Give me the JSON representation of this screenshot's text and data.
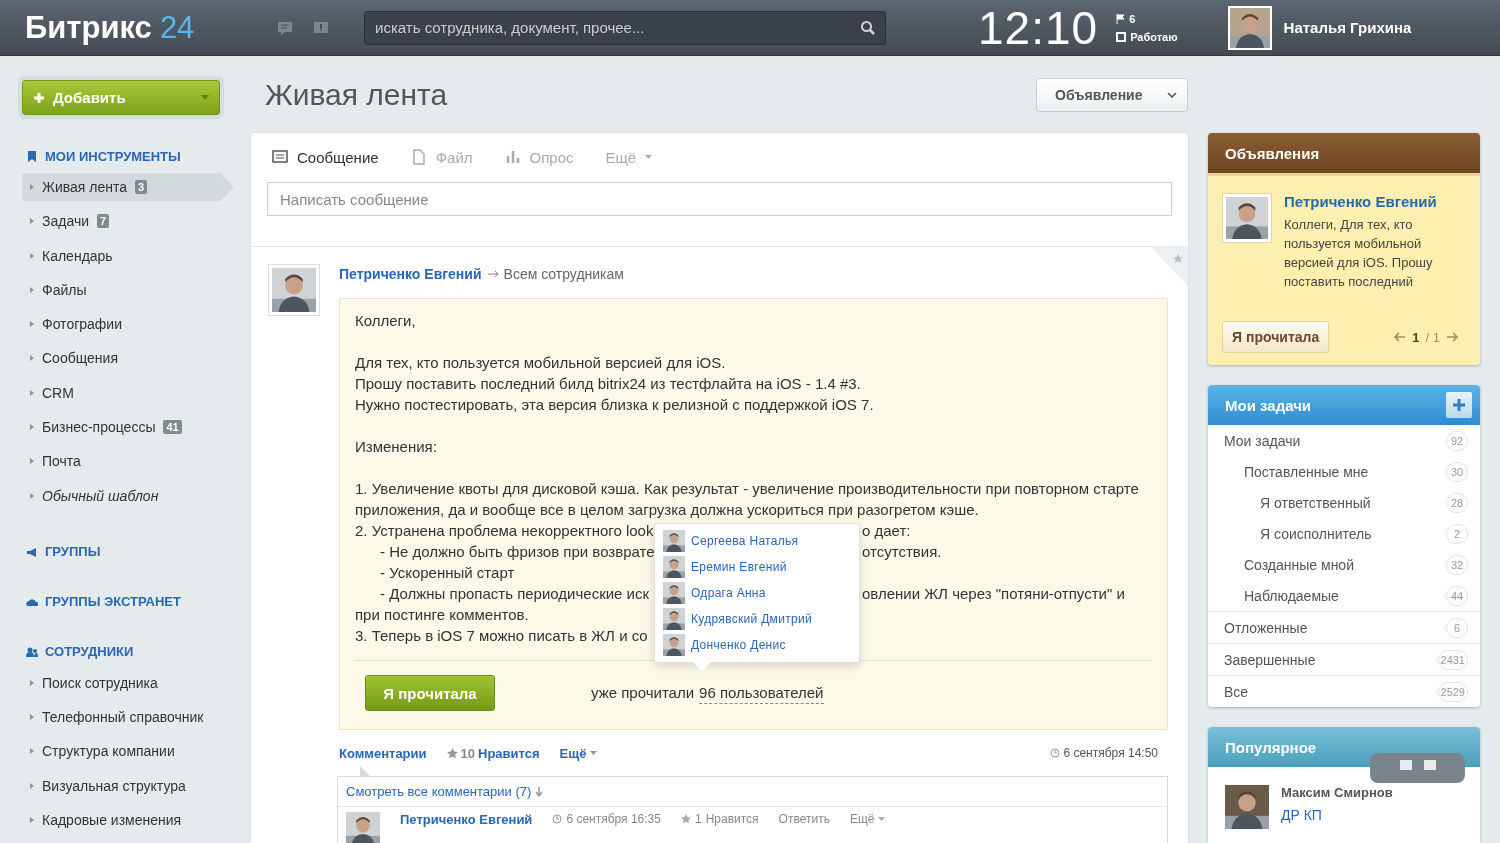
{
  "header": {
    "logo": {
      "name": "Битрикс",
      "number": "24"
    },
    "search": {
      "placeholder": "искать сотрудника, документ, прочее..."
    },
    "time": "12:10",
    "flags": "6",
    "status": "Работаю",
    "user": "Наталья Грихина"
  },
  "add_button": {
    "label": "Добавить"
  },
  "sidebar": [
    {
      "title": "МОИ ИНСТРУМЕНТЫ",
      "items": [
        {
          "label": "Живая лента",
          "badge": "3",
          "selected": true,
          "kind": "link"
        },
        {
          "label": "Задачи",
          "badge": "7",
          "selected": false,
          "kind": "link"
        },
        {
          "label": "Календарь",
          "selected": false,
          "kind": "link"
        },
        {
          "label": "Файлы",
          "selected": false,
          "kind": "link"
        },
        {
          "label": "Фотографии",
          "selected": false,
          "kind": "link"
        },
        {
          "label": "Сообщения",
          "selected": false,
          "kind": "link"
        },
        {
          "label": "CRM",
          "selected": false,
          "kind": "link"
        },
        {
          "label": "Бизнес-процессы",
          "badge": "41",
          "selected": false,
          "kind": "link"
        },
        {
          "label": "Почта",
          "selected": false,
          "kind": "link"
        },
        {
          "label": "Обычный шаблон",
          "selected": false,
          "kind": "template"
        }
      ]
    },
    {
      "title": "ГРУППЫ"
    },
    {
      "title": "ГРУППЫ ЭКСТРАНЕТ"
    },
    {
      "title": "СОТРУДНИКИ",
      "items": [
        {
          "label": "Поиск сотрудника",
          "selected": false,
          "kind": "link"
        },
        {
          "label": "Телефонный справочник",
          "selected": false,
          "kind": "link"
        },
        {
          "label": "Структура компании",
          "selected": false,
          "kind": "link"
        },
        {
          "label": "Визуальная структура",
          "selected": false,
          "kind": "link"
        },
        {
          "label": "Кадровые изменения",
          "selected": false,
          "kind": "link"
        }
      ]
    }
  ],
  "page_title": "Живая лента",
  "announce_dropdown": "Объявление",
  "composer": {
    "tabs": [
      {
        "label": "Сообщение",
        "selected": true
      },
      {
        "label": "Файл",
        "selected": false
      },
      {
        "label": "Опрос",
        "selected": false
      },
      {
        "label": "Ещё",
        "selected": false
      }
    ],
    "placeholder": "Написать сообщение"
  },
  "post": {
    "author": "Петриченко Евгений",
    "recipient": "Всем сотрудникам",
    "paragraphs": [
      [
        {
          "text": "Коллеги,"
        }
      ],
      [
        {
          "text": "Для тех, кто пользуется мобильной версией для iOS."
        },
        {
          "text": "Прошу поставить последний билд bitrix24 из тестфлайта на iOS - 1.4 #3."
        },
        {
          "text": "Нужно постестировать, эта версия близка к релизной с поддержкой iOS 7."
        }
      ],
      [
        {
          "text": "Изменения:"
        }
      ],
      [
        {
          "text": "1. Увеличение квоты для дисковой кэша. Как результат - увеличение производительности при повторном старте"
        },
        {
          "text": "приложения, да и вообще все в целом загрузка должна ускориться при разогретом кэше."
        },
        {
          "text": "2. Устранена проблема некорректного look",
          "after": "о дает:"
        },
        {
          "text": "- Не должно быть фризов при возврате",
          "after": "отсутствия.",
          "indent": true
        },
        {
          "text": "- Ускоренный старт",
          "indent": true
        },
        {
          "text": "- Должны пропасть периодические иск",
          "after": "овлении ЖЛ через \"потяни-отпусти\" и",
          "indent": true
        },
        {
          "text": "при постинге комментов."
        },
        {
          "text": "3. Теперь в iOS 7 можно писать в ЖЛ и со"
        }
      ]
    ],
    "readers_popup": [
      "Сергеева Наталья",
      "Еремин Евгений",
      "Одрага Анна",
      "Кудрявский Дмитрий",
      "Донченко Денис"
    ],
    "read_button": "Я прочитала",
    "read_text": "уже прочитали",
    "read_link": "96 пользователей",
    "actions": {
      "comments": "Комментарии",
      "likes": "10",
      "like": "Нравится",
      "more": "Ещё",
      "date": "6 сентября 14:50"
    },
    "view_all": "Смотреть все комментарии (7)",
    "comment": {
      "author": "Петриченко Евгений",
      "date": "6 сентября 16:35",
      "likes": "1",
      "like": "Нравится",
      "reply": "Ответить",
      "more": "Ещё"
    }
  },
  "announcements": {
    "title": "Объявления",
    "author": "Петриченко Евгений",
    "text": "Коллеги, Для тех, кто пользуется мобильной версией для iOS. Прошу поставить последний",
    "button": "Я прочитала",
    "page": "1",
    "total": "/ 1"
  },
  "tasks": {
    "title": "Мои задачи",
    "items": [
      {
        "label": "Мои задачи",
        "count": "92",
        "children": [
          {
            "label": "Поставленные мне",
            "count": "30",
            "children": [
              {
                "label": "Я ответственный",
                "count": "28"
              },
              {
                "label": "Я соисполнитель",
                "count": "2"
              }
            ]
          },
          {
            "label": "Созданные мной",
            "count": "32"
          },
          {
            "label": "Наблюдаемые",
            "count": "44"
          }
        ]
      },
      {
        "label": "Отложенные",
        "count": "6"
      },
      {
        "label": "Завершенные",
        "count": "2431"
      },
      {
        "label": "Все",
        "count": "2529"
      }
    ]
  },
  "popular": {
    "title": "Популярное",
    "name": "Максим Смирнов",
    "subtitle": "ДР КП"
  }
}
